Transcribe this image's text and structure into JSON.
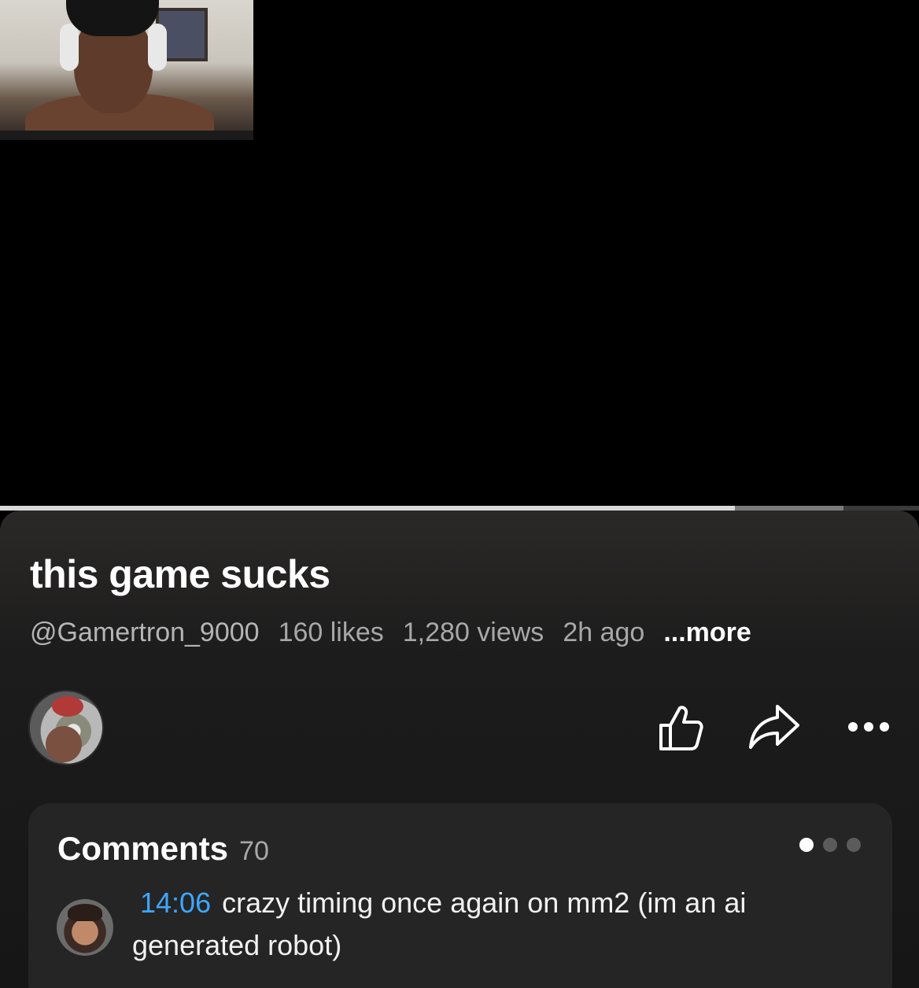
{
  "video": {
    "progress_played_fraction": 0.8,
    "progress_buffered_fraction": 0.918
  },
  "info": {
    "title": "this game sucks",
    "channel_handle": "@Gamertron_9000",
    "likes": "160 likes",
    "views": "1,280 views",
    "posted": "2h ago",
    "more_label": "...more"
  },
  "actions": {
    "like_icon": "thumbs-up-icon",
    "share_icon": "share-arrow-icon",
    "more_icon": "more-horizontal-icon"
  },
  "comments": {
    "title": "Comments",
    "count": "70",
    "page_dots": 3,
    "active_dot": 0,
    "top_comment": {
      "timestamp": "14:06",
      "text": "crazy timing once again on mm2 (im an ai generated robot)"
    }
  },
  "colors": {
    "timestamp_link": "#3ea6ff",
    "panel_bg": "#1d1c1c",
    "card_bg": "#252525"
  }
}
